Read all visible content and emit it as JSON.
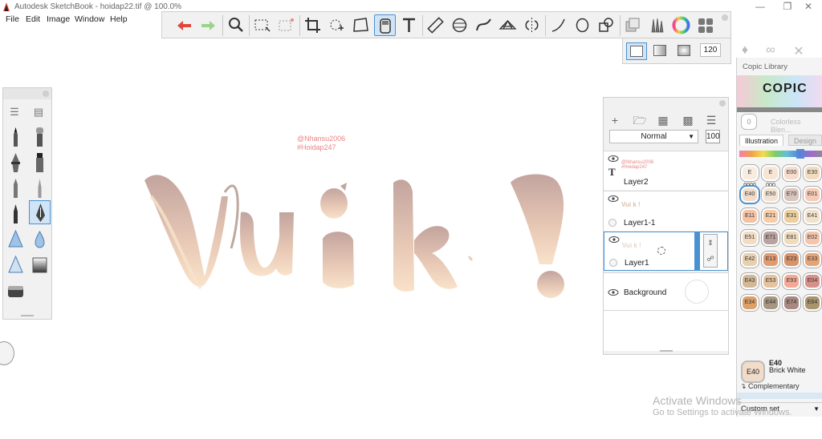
{
  "window": {
    "title": "Autodesk SketchBook - hoidap22.tif @ 100.0%",
    "controls": [
      "minimize",
      "maximize",
      "close"
    ]
  },
  "menu": [
    "File",
    "Edit",
    "Image",
    "Window",
    "Help"
  ],
  "toolbar": {
    "tools": [
      "undo",
      "redo",
      "zoom",
      "select-rect",
      "select-lasso",
      "crop",
      "distort",
      "transform",
      "copic-marker",
      "text",
      "ruler",
      "ellipse-guide",
      "french-curve",
      "perspective",
      "symmetry",
      "stroke",
      "ellipse",
      "shape",
      "layers",
      "brushes",
      "color-wheel",
      "palette"
    ],
    "selected_tool": "copic-marker"
  },
  "sub_toolbar": {
    "brush_size": "120"
  },
  "canvas": {
    "watermark_line1": "@Nhansu2006",
    "watermark_line2": "#Hoidap247"
  },
  "layers": {
    "blend_mode": "Normal",
    "opacity": "100",
    "items": [
      {
        "name": "Layer2",
        "thumb_line1": "@Nhansu2006",
        "thumb_line2": "#Hoidap247"
      },
      {
        "name": "Layer1-1",
        "thumb": "Vui k !"
      },
      {
        "name": "Layer1",
        "thumb": "Vui k !"
      },
      {
        "name": "Background"
      }
    ]
  },
  "copic": {
    "title": "Copic Library",
    "logo": "COPIC",
    "colorless_code": "0",
    "colorless_label": "Colorless Blen...",
    "tabs": [
      "Illustration",
      "Design"
    ],
    "swatches": [
      {
        "code": "E 0000",
        "color": "#f8ece0"
      },
      {
        "code": "E 000",
        "color": "#f7e6d6"
      },
      {
        "code": "E00",
        "color": "#f6dccb"
      },
      {
        "code": "E30",
        "color": "#f2dcc0"
      },
      {
        "code": "E40",
        "color": "#f1dcc9"
      },
      {
        "code": "E50",
        "color": "#f2e2d2"
      },
      {
        "code": "E70",
        "color": "#d9c6bd"
      },
      {
        "code": "E01",
        "color": "#f6cbb8"
      },
      {
        "code": "E11",
        "color": "#f3c3a6"
      },
      {
        "code": "E21",
        "color": "#f5cda8"
      },
      {
        "code": "E31",
        "color": "#edcf9f"
      },
      {
        "code": "E41",
        "color": "#f1e2cb"
      },
      {
        "code": "E51",
        "color": "#f3dcc4"
      },
      {
        "code": "E71",
        "color": "#b9a3a0"
      },
      {
        "code": "E81",
        "color": "#eedcbd"
      },
      {
        "code": "E02",
        "color": "#f4c5ab"
      },
      {
        "code": "E42",
        "color": "#e8cfae"
      },
      {
        "code": "E13",
        "color": "#e49a6f"
      },
      {
        "code": "E23",
        "color": "#d9936a"
      },
      {
        "code": "E33",
        "color": "#e4a476"
      },
      {
        "code": "E43",
        "color": "#d3b897"
      },
      {
        "code": "E53",
        "color": "#e5c39f"
      },
      {
        "code": "E93",
        "color": "#f2a996"
      },
      {
        "code": "E04",
        "color": "#d8908a"
      },
      {
        "code": "E34",
        "color": "#dca16b"
      },
      {
        "code": "E44",
        "color": "#a69682"
      },
      {
        "code": "E74",
        "color": "#a88981"
      },
      {
        "code": "E84",
        "color": "#a9946e"
      }
    ],
    "selected_code": "E40",
    "selected_name": "Brick White",
    "complementary_label": "Complementary",
    "custom_set_label": "Custom set"
  },
  "watermark": {
    "title": "Activate Windows",
    "subtitle": "Go to Settings to activate Windows."
  },
  "colors": {
    "accent": "#4b91d1",
    "panel_bg": "#f1f1f1",
    "gradient_top": "#c8aba4",
    "gradient_bottom": "#f7dcc3"
  }
}
